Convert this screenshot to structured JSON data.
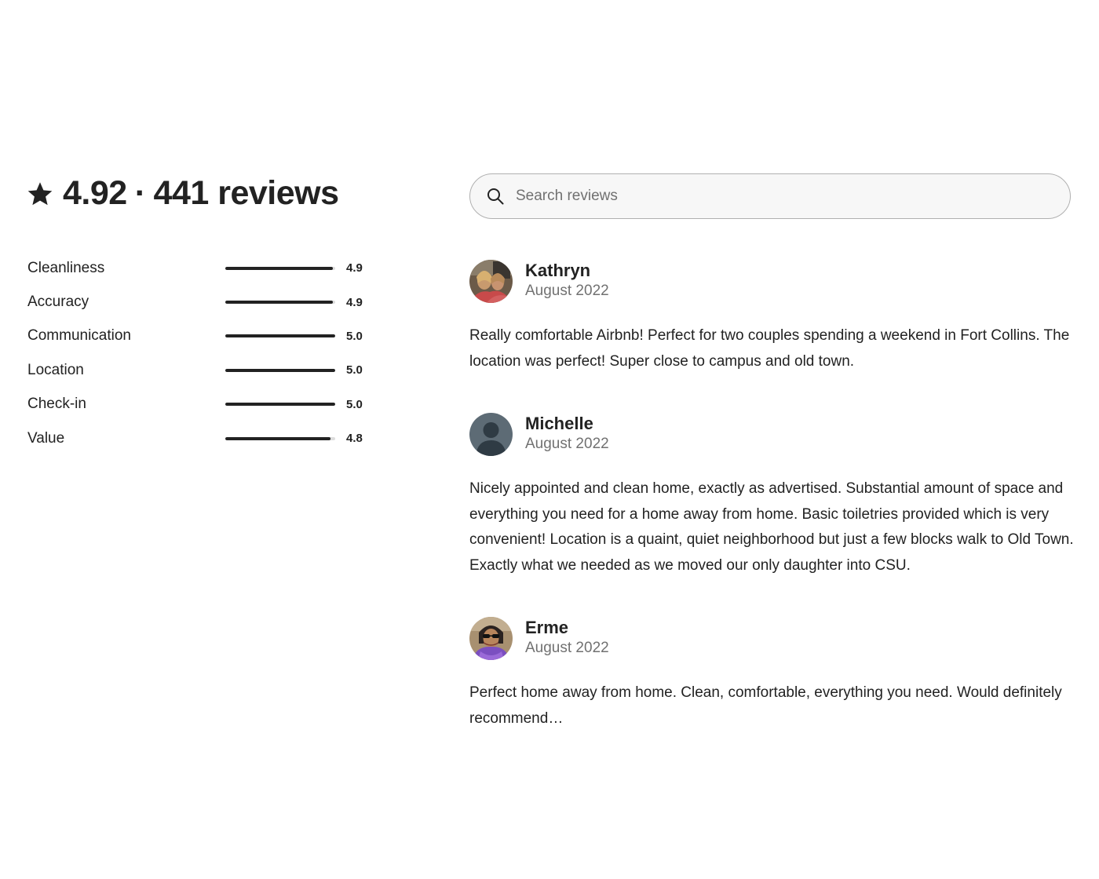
{
  "summary": {
    "rating": "4.92",
    "separator": "·",
    "reviews_count": "441 reviews"
  },
  "categories": [
    {
      "label": "Cleanliness",
      "score": "4.9",
      "fill_fraction": 0.98
    },
    {
      "label": "Accuracy",
      "score": "4.9",
      "fill_fraction": 0.98
    },
    {
      "label": "Communication",
      "score": "5.0",
      "fill_fraction": 1.0
    },
    {
      "label": "Location",
      "score": "5.0",
      "fill_fraction": 1.0
    },
    {
      "label": "Check-in",
      "score": "5.0",
      "fill_fraction": 1.0
    },
    {
      "label": "Value",
      "score": "4.8",
      "fill_fraction": 0.96
    }
  ],
  "search": {
    "placeholder": "Search reviews",
    "icon": "search-icon"
  },
  "reviews": [
    {
      "name": "Kathryn",
      "date": "August 2022",
      "avatar": "photo-two-people",
      "text": "Really comfortable Airbnb! Perfect for two couples spending a weekend in Fort Collins. The location was perfect! Super close to campus and old town."
    },
    {
      "name": "Michelle",
      "date": "August 2022",
      "avatar": "default-person-silhouette",
      "text": "Nicely appointed and clean home, exactly as advertised. Substantial amount of space and everything you need for a home away from home. Basic toiletries provided which is very convenient! Location is a quaint, quiet neighborhood but just a few blocks walk to Old Town. Exactly what we needed as we moved our only daughter into CSU."
    },
    {
      "name": "Erme",
      "date": "August 2022",
      "avatar": "photo-person-sunglasses-purple-scarf",
      "text": "Perfect home away from home. Clean, comfortable, everything you need. Would definitely recommend…"
    }
  ],
  "colors": {
    "text_primary": "#222222",
    "text_secondary": "#717171",
    "bar_fill": "#222222",
    "bar_track": "#dddddd",
    "search_border": "#b0b0b0",
    "search_bg": "#f7f7f7"
  }
}
